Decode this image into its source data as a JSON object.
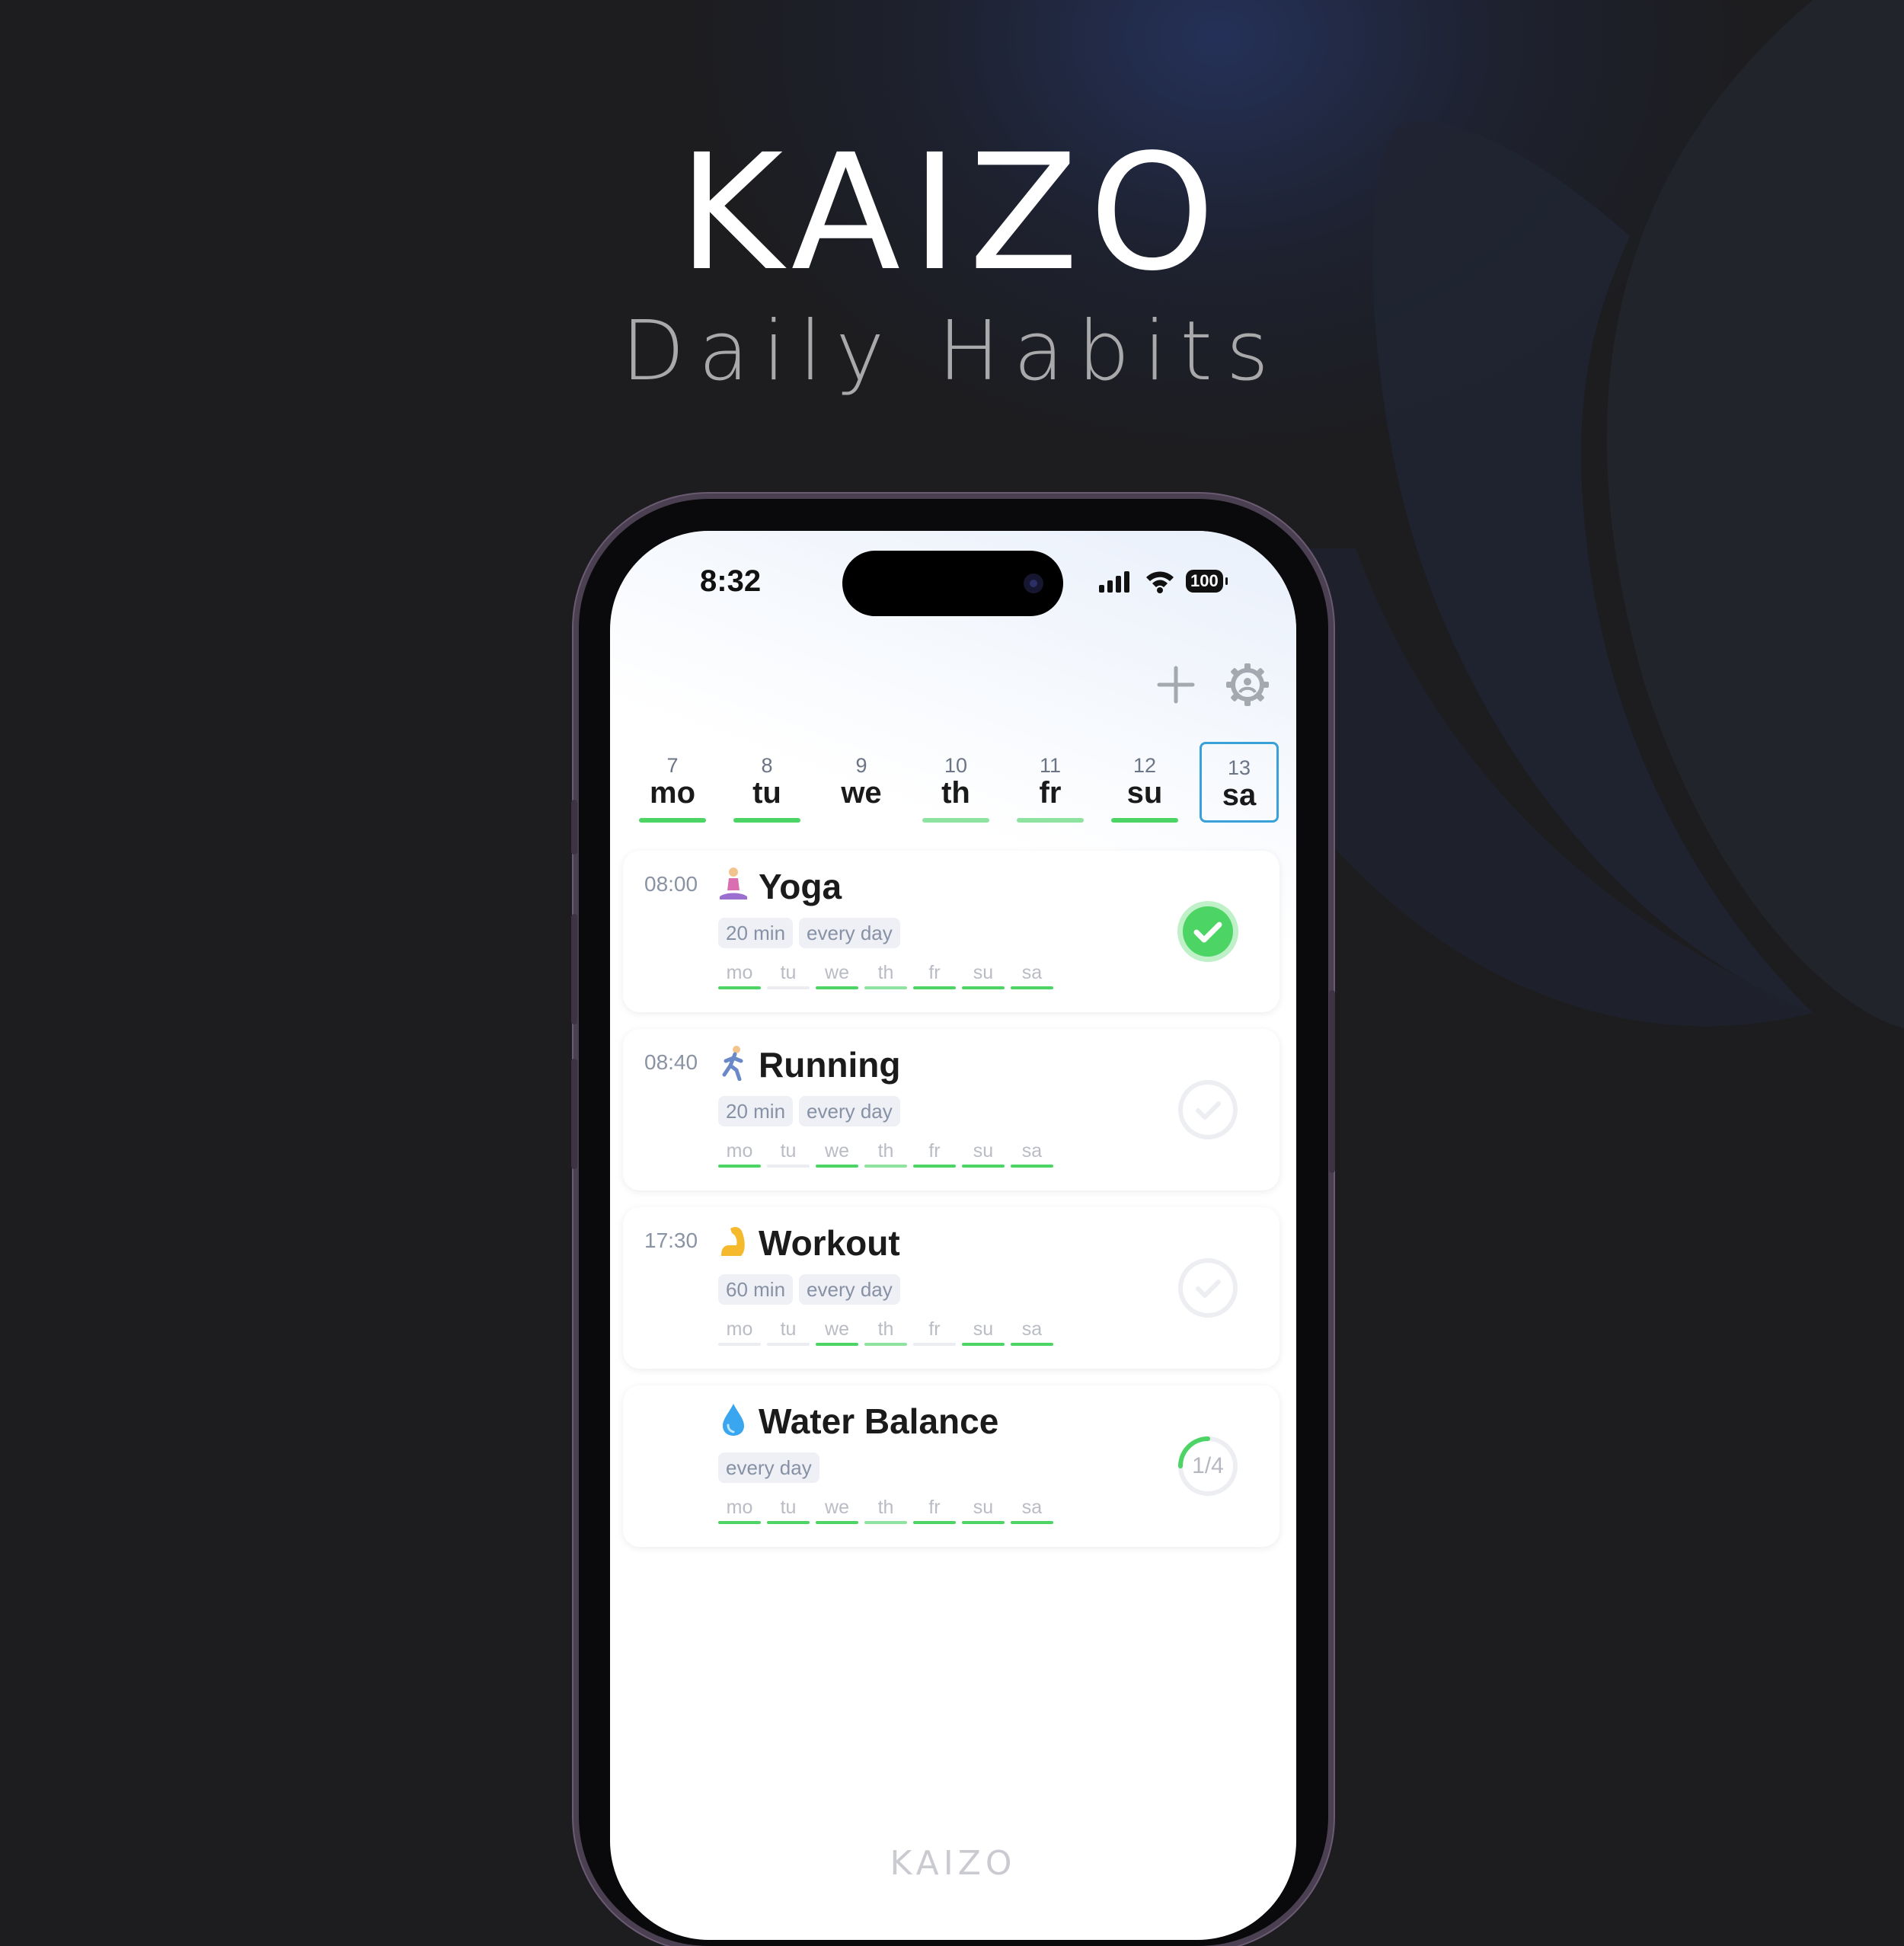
{
  "brand": {
    "title": "KAIZO",
    "subtitle": "Daily Habits"
  },
  "status_bar": {
    "time": "8:32",
    "battery": "100"
  },
  "toolbar": {
    "add_icon": "plus-icon",
    "settings_icon": "gear-icon"
  },
  "colors": {
    "green": "#4cd465",
    "light_green": "#8fe3a0",
    "selected_border": "#3aa0d8",
    "inactive": "#ebedf1"
  },
  "days": [
    {
      "num": "7",
      "name": "mo",
      "status": "done"
    },
    {
      "num": "8",
      "name": "tu",
      "status": "done"
    },
    {
      "num": "9",
      "name": "we",
      "status": "none"
    },
    {
      "num": "10",
      "name": "th",
      "status": "partial"
    },
    {
      "num": "11",
      "name": "fr",
      "status": "partial"
    },
    {
      "num": "12",
      "name": "su",
      "status": "done"
    },
    {
      "num": "13",
      "name": "sa",
      "status": "selected"
    }
  ],
  "habits": [
    {
      "time": "08:00",
      "emoji": "person-in-lotus-position-icon",
      "name": "Yoga",
      "tags": [
        "20 min",
        "every day"
      ],
      "week": [
        {
          "d": "mo",
          "s": "done"
        },
        {
          "d": "tu",
          "s": "none"
        },
        {
          "d": "we",
          "s": "done"
        },
        {
          "d": "th",
          "s": "partial"
        },
        {
          "d": "fr",
          "s": "done"
        },
        {
          "d": "su",
          "s": "done"
        },
        {
          "d": "sa",
          "s": "done"
        }
      ],
      "state": "done"
    },
    {
      "time": "08:40",
      "emoji": "person-running-icon",
      "name": "Running",
      "tags": [
        "20 min",
        "every day"
      ],
      "week": [
        {
          "d": "mo",
          "s": "done"
        },
        {
          "d": "tu",
          "s": "none"
        },
        {
          "d": "we",
          "s": "done"
        },
        {
          "d": "th",
          "s": "partial"
        },
        {
          "d": "fr",
          "s": "done"
        },
        {
          "d": "su",
          "s": "done"
        },
        {
          "d": "sa",
          "s": "done"
        }
      ],
      "state": "todo"
    },
    {
      "time": "17:30",
      "emoji": "flexed-biceps-icon",
      "name": "Workout",
      "tags": [
        "60 min",
        "every day"
      ],
      "week": [
        {
          "d": "mo",
          "s": "none"
        },
        {
          "d": "tu",
          "s": "none"
        },
        {
          "d": "we",
          "s": "done"
        },
        {
          "d": "th",
          "s": "partial"
        },
        {
          "d": "fr",
          "s": "none"
        },
        {
          "d": "su",
          "s": "done"
        },
        {
          "d": "sa",
          "s": "done"
        }
      ],
      "state": "todo"
    },
    {
      "time": "",
      "emoji": "water-drop-icon",
      "name": "Water Balance",
      "tags": [
        "every day"
      ],
      "week": [
        {
          "d": "mo",
          "s": "done"
        },
        {
          "d": "tu",
          "s": "done"
        },
        {
          "d": "we",
          "s": "done"
        },
        {
          "d": "th",
          "s": "partial"
        },
        {
          "d": "fr",
          "s": "done"
        },
        {
          "d": "su",
          "s": "done"
        },
        {
          "d": "sa",
          "s": "done"
        }
      ],
      "state": "progress",
      "progress_label": "1/4",
      "progress_fraction": 0.25
    }
  ],
  "footer": {
    "logo": "KAIZO"
  }
}
